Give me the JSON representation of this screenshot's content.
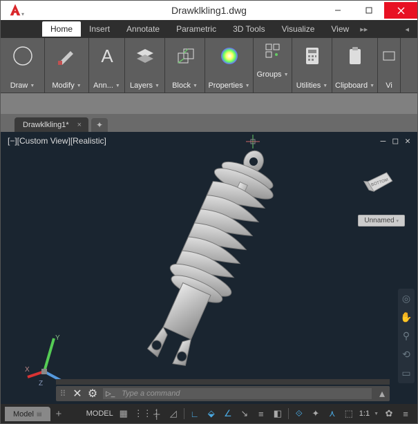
{
  "title": "Drawklkling1.dwg",
  "menubar": {
    "home": "Home",
    "insert": "Insert",
    "annotate": "Annotate",
    "parametric": "Parametric",
    "tools3d": "3D Tools",
    "visualize": "Visualize",
    "view": "View"
  },
  "ribbon": {
    "draw": "Draw",
    "modify": "Modify",
    "annotation": "Ann...",
    "layers": "Layers",
    "block": "Block",
    "properties": "Properties",
    "groups": "Groups",
    "utilities": "Utilities",
    "clipboard": "Clipboard",
    "view": "Vi"
  },
  "doctab": {
    "name": "Drawklkling1*"
  },
  "viewport": {
    "label": "[−][Custom View][Realistic]",
    "nav_label": "Unnamed",
    "cube_face": "BOTTOM"
  },
  "cmdline": {
    "placeholder": "Type a command"
  },
  "status": {
    "model_tab": "Model",
    "model_btn": "MODEL",
    "scale": "1:1"
  },
  "ucs": {
    "x": "X",
    "y": "Y",
    "z": "Z"
  }
}
